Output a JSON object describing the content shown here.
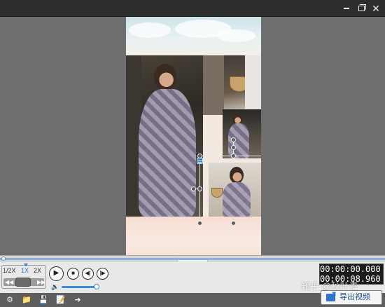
{
  "window": {
    "icons": [
      "minimize-icon",
      "maximize-icon",
      "close-icon"
    ],
    "close_glyph": "✕"
  },
  "playback": {
    "speeds": [
      "1/2X",
      "1X",
      "2X"
    ],
    "active_speed": "1X",
    "volume_level": 0.9,
    "progress": 0.0
  },
  "timecode": {
    "current": "00:00:00.000",
    "total": "00:00:08.960"
  },
  "export_button": {
    "label": "导出视频"
  },
  "watermark": {
    "text": "知乎 @秋叶青"
  },
  "toolbar": {
    "icons": [
      "settings-icon",
      "open-folder-icon",
      "save-icon",
      "save-as-icon",
      "share-icon"
    ]
  },
  "colors": {
    "accent": "#1e78d7",
    "titlebar": "#2e2e2e",
    "stage": "#6e6e6e",
    "controls": "#e9e9e9"
  }
}
